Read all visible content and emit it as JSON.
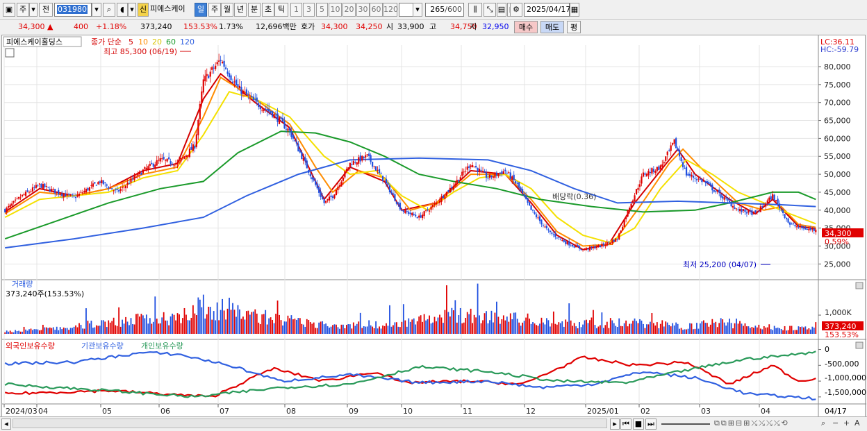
{
  "toolbar": {
    "type_btn": "주",
    "prev_btn": "전",
    "code": "031980",
    "new_btn": "신",
    "name": "피에스케이",
    "periods": [
      "일",
      "주",
      "월",
      "년",
      "분",
      "초",
      "틱"
    ],
    "intervals": [
      "1",
      "3",
      "5",
      "10",
      "20",
      "30",
      "60",
      "120"
    ],
    "count": "265",
    "count_total": "/600",
    "date": "2025/04/17"
  },
  "quote": {
    "price": "34,300",
    "arrow": "▲",
    "change": "400",
    "change_pct": "+1.18%",
    "volume": "373,240",
    "vol_ratio": "153.53%",
    "turnover": "1.73%",
    "amount": "12,696백만",
    "bid_label": "호가",
    "ask": "34,300",
    "bid": "34,250",
    "open_label": "시",
    "open": "33,900",
    "high_label": "고",
    "high": "34,750",
    "low_label": "저",
    "low": "32,950",
    "buy_btn": "매수",
    "sell_btn": "매도",
    "eval_btn": "평"
  },
  "main_panel": {
    "stock_title": "피에스케이홀딩스",
    "ma_label": "종가 단순",
    "ma_periods": [
      "5",
      "10",
      "20",
      "60",
      "120"
    ],
    "ma_colors": [
      "#d40000",
      "#ff8c00",
      "#f4e000",
      "#1a9a2a",
      "#3060e0"
    ],
    "lc": "LC:36.11",
    "hc": "HC:-59.79",
    "high_note": "최고 85,300 (06/19)",
    "low_note": "최저 25,200 (04/07)",
    "dividend_note": "배당락(0.36)",
    "price_tag": "34,300",
    "pct_tag": "0.59%"
  },
  "volume_panel": {
    "title": "거래량",
    "info": "373,240주(153.53%)",
    "axis_label": "1,000K",
    "tag": "373,240",
    "tag2": "153.53%"
  },
  "holding_panel": {
    "series_labels": [
      "외국인보유수량",
      "기관보유수량",
      "개인보유수량"
    ],
    "colors": [
      "#e00000",
      "#3060e0",
      "#2a9a5a"
    ],
    "axis_labels": [
      "0",
      "-500,000",
      "-1,000,000",
      "-1,500,000"
    ]
  },
  "x_axis": {
    "labels": [
      "2024/03",
      "04",
      "05",
      "06",
      "07",
      "08",
      "09",
      "10",
      "11",
      "12",
      "2025/01",
      "02",
      "03",
      "04"
    ],
    "right_label": "04/17"
  },
  "chart_data": {
    "type": "candlestick",
    "title": "피에스케이홀딩스",
    "y_ticks": [
      "80,000",
      "75,000",
      "70,000",
      "65,000",
      "60,000",
      "55,000",
      "50,000",
      "45,000",
      "40,000",
      "35,000",
      "30,000",
      "25,000"
    ],
    "ylim": [
      21000,
      86000
    ],
    "months": [
      "2024/03",
      "04",
      "05",
      "06",
      "07",
      "08",
      "09",
      "10",
      "11",
      "12",
      "2025/01",
      "02",
      "03",
      "04"
    ],
    "close_path": [
      [
        0,
        40000
      ],
      [
        10,
        44000
      ],
      [
        20,
        47000
      ],
      [
        30,
        45000
      ],
      [
        40,
        43500
      ],
      [
        55,
        48000
      ],
      [
        65,
        45000
      ],
      [
        80,
        51000
      ],
      [
        90,
        54000
      ],
      [
        100,
        53000
      ],
      [
        110,
        58000
      ],
      [
        115,
        76000
      ],
      [
        125,
        82000
      ],
      [
        135,
        74000
      ],
      [
        145,
        70000
      ],
      [
        155,
        67000
      ],
      [
        165,
        62000
      ],
      [
        175,
        52000
      ],
      [
        185,
        42000
      ],
      [
        190,
        44000
      ],
      [
        200,
        53000
      ],
      [
        210,
        55000
      ],
      [
        220,
        48000
      ],
      [
        230,
        40000
      ],
      [
        240,
        38000
      ],
      [
        250,
        42000
      ],
      [
        260,
        47000
      ],
      [
        270,
        53000
      ],
      [
        280,
        49000
      ],
      [
        290,
        51000
      ],
      [
        297,
        47000
      ],
      [
        305,
        40000
      ],
      [
        315,
        34000
      ],
      [
        325,
        31000
      ],
      [
        335,
        29000
      ],
      [
        345,
        30000
      ],
      [
        355,
        32000
      ],
      [
        362,
        41000
      ],
      [
        370,
        50000
      ],
      [
        380,
        52000
      ],
      [
        388,
        59000
      ],
      [
        395,
        50000
      ],
      [
        405,
        48000
      ],
      [
        415,
        44000
      ],
      [
        425,
        40000
      ],
      [
        435,
        39000
      ],
      [
        445,
        44000
      ],
      [
        455,
        36000
      ],
      [
        462,
        35000
      ],
      [
        470,
        34300
      ]
    ],
    "ma_series": [
      {
        "name": "5",
        "points": [
          [
            0,
            39500
          ],
          [
            20,
            46000
          ],
          [
            40,
            44000
          ],
          [
            60,
            46000
          ],
          [
            80,
            51000
          ],
          [
            100,
            53000
          ],
          [
            115,
            71000
          ],
          [
            125,
            78000
          ],
          [
            145,
            70000
          ],
          [
            165,
            63000
          ],
          [
            175,
            53000
          ],
          [
            185,
            43000
          ],
          [
            200,
            52000
          ],
          [
            220,
            48000
          ],
          [
            230,
            40000
          ],
          [
            250,
            42000
          ],
          [
            270,
            51000
          ],
          [
            290,
            50000
          ],
          [
            305,
            42000
          ],
          [
            320,
            33000
          ],
          [
            335,
            29000
          ],
          [
            350,
            30500
          ],
          [
            365,
            42000
          ],
          [
            380,
            51000
          ],
          [
            390,
            57000
          ],
          [
            400,
            50000
          ],
          [
            420,
            43000
          ],
          [
            435,
            39000
          ],
          [
            445,
            43000
          ],
          [
            460,
            35500
          ],
          [
            470,
            34800
          ]
        ]
      },
      {
        "name": "10",
        "points": [
          [
            0,
            39000
          ],
          [
            20,
            45000
          ],
          [
            40,
            44000
          ],
          [
            60,
            46000
          ],
          [
            80,
            50000
          ],
          [
            100,
            52000
          ],
          [
            115,
            66000
          ],
          [
            125,
            77000
          ],
          [
            145,
            71000
          ],
          [
            165,
            64000
          ],
          [
            180,
            52000
          ],
          [
            190,
            45000
          ],
          [
            205,
            51000
          ],
          [
            220,
            49000
          ],
          [
            235,
            40000
          ],
          [
            250,
            42000
          ],
          [
            270,
            50000
          ],
          [
            290,
            50000
          ],
          [
            305,
            43000
          ],
          [
            320,
            34000
          ],
          [
            335,
            30000
          ],
          [
            352,
            30500
          ],
          [
            368,
            41000
          ],
          [
            385,
            53000
          ],
          [
            393,
            57000
          ],
          [
            405,
            51000
          ],
          [
            425,
            42000
          ],
          [
            440,
            40000
          ],
          [
            450,
            41000
          ],
          [
            460,
            36000
          ],
          [
            470,
            35200
          ]
        ]
      },
      {
        "name": "20",
        "points": [
          [
            0,
            38000
          ],
          [
            20,
            43000
          ],
          [
            40,
            44000
          ],
          [
            60,
            45000
          ],
          [
            80,
            49000
          ],
          [
            100,
            51000
          ],
          [
            115,
            61000
          ],
          [
            130,
            73000
          ],
          [
            145,
            71000
          ],
          [
            165,
            66000
          ],
          [
            185,
            55000
          ],
          [
            200,
            50000
          ],
          [
            215,
            51000
          ],
          [
            230,
            44000
          ],
          [
            245,
            40000
          ],
          [
            260,
            45000
          ],
          [
            275,
            49000
          ],
          [
            290,
            50000
          ],
          [
            305,
            46000
          ],
          [
            320,
            38000
          ],
          [
            335,
            33000
          ],
          [
            350,
            31000
          ],
          [
            365,
            35000
          ],
          [
            380,
            46000
          ],
          [
            395,
            54000
          ],
          [
            410,
            50000
          ],
          [
            425,
            45000
          ],
          [
            440,
            42000
          ],
          [
            455,
            39000
          ],
          [
            470,
            36200
          ]
        ]
      },
      {
        "name": "60",
        "points": [
          [
            0,
            32000
          ],
          [
            30,
            37000
          ],
          [
            60,
            42000
          ],
          [
            90,
            46000
          ],
          [
            115,
            48000
          ],
          [
            135,
            56000
          ],
          [
            160,
            62000
          ],
          [
            180,
            61500
          ],
          [
            200,
            59000
          ],
          [
            220,
            55000
          ],
          [
            240,
            50000
          ],
          [
            260,
            48000
          ],
          [
            285,
            46000
          ],
          [
            310,
            43000
          ],
          [
            340,
            41000
          ],
          [
            370,
            39500
          ],
          [
            400,
            40000
          ],
          [
            420,
            42000
          ],
          [
            445,
            45000
          ],
          [
            460,
            45000
          ],
          [
            470,
            43000
          ]
        ]
      },
      {
        "name": "120",
        "points": [
          [
            0,
            29500
          ],
          [
            40,
            32000
          ],
          [
            80,
            35000
          ],
          [
            115,
            38000
          ],
          [
            140,
            44000
          ],
          [
            170,
            50000
          ],
          [
            200,
            54000
          ],
          [
            240,
            54500
          ],
          [
            280,
            54000
          ],
          [
            305,
            51000
          ],
          [
            330,
            46000
          ],
          [
            355,
            42000
          ],
          [
            390,
            42500
          ],
          [
            420,
            42000
          ],
          [
            450,
            41500
          ],
          [
            470,
            41000
          ]
        ]
      }
    ],
    "volume_spikes": [
      [
        0,
        180000
      ],
      [
        40,
        500000
      ],
      [
        50,
        800000
      ],
      [
        95,
        1300000
      ],
      [
        115,
        2100000
      ],
      [
        180,
        700000
      ],
      [
        220,
        750000
      ],
      [
        265,
        1500000
      ],
      [
        330,
        800000
      ],
      [
        365,
        900000
      ],
      [
        395,
        600000
      ],
      [
        415,
        900000
      ],
      [
        440,
        550000
      ],
      [
        470,
        373240
      ]
    ],
    "holding_series": [
      {
        "name": "외국인보유수량",
        "points": [
          [
            0,
            -1400000
          ],
          [
            60,
            -1300000
          ],
          [
            120,
            -1500000
          ],
          [
            155,
            -600000
          ],
          [
            185,
            -1000000
          ],
          [
            215,
            -700000
          ],
          [
            230,
            -1050000
          ],
          [
            270,
            -1000000
          ],
          [
            300,
            -1100000
          ],
          [
            335,
            -250000
          ],
          [
            365,
            -500000
          ],
          [
            395,
            -400000
          ],
          [
            420,
            -1100000
          ],
          [
            445,
            -500000
          ],
          [
            460,
            -1000000
          ],
          [
            470,
            -900000
          ]
        ]
      },
      {
        "name": "기관보유수량",
        "points": [
          [
            0,
            -450000
          ],
          [
            40,
            -400000
          ],
          [
            80,
            -100000
          ],
          [
            100,
            -150000
          ],
          [
            130,
            -500000
          ],
          [
            160,
            -1000000
          ],
          [
            200,
            -800000
          ],
          [
            240,
            -1050000
          ],
          [
            280,
            -1000000
          ],
          [
            310,
            -1200000
          ],
          [
            340,
            -1100000
          ],
          [
            370,
            -700000
          ],
          [
            400,
            -900000
          ],
          [
            430,
            -1400000
          ],
          [
            470,
            -1550000
          ]
        ]
      },
      {
        "name": "개인보유수량",
        "points": [
          [
            0,
            -1100000
          ],
          [
            60,
            -1300000
          ],
          [
            110,
            -1500000
          ],
          [
            160,
            -1200000
          ],
          [
            200,
            -1100000
          ],
          [
            240,
            -550000
          ],
          [
            280,
            -700000
          ],
          [
            320,
            -1000000
          ],
          [
            360,
            -1050000
          ],
          [
            400,
            -600000
          ],
          [
            430,
            -300000
          ],
          [
            460,
            -150000
          ],
          [
            470,
            -50000
          ]
        ]
      }
    ]
  }
}
